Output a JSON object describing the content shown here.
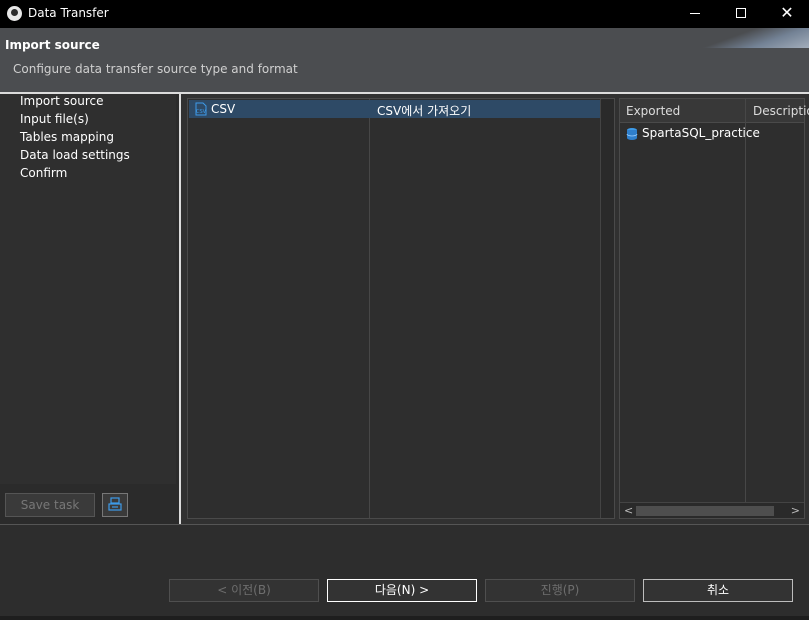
{
  "window": {
    "title": "Data Transfer",
    "controls": {
      "minimize": "minimize",
      "maximize": "maximize",
      "close": "✕"
    }
  },
  "header": {
    "title": "Import source",
    "description": "Configure data transfer source type and format"
  },
  "nav": {
    "items": [
      {
        "label": "Import source"
      },
      {
        "label": "Input file(s)"
      },
      {
        "label": "Tables mapping"
      },
      {
        "label": "Data load settings"
      },
      {
        "label": "Confirm"
      }
    ],
    "save_task_label": "Save task"
  },
  "source_table": {
    "rows": [
      {
        "icon": "csv-file-icon",
        "name": "CSV",
        "description": "CSV에서 가져오기"
      }
    ]
  },
  "export_table": {
    "columns": [
      "Exported",
      "Descriptio"
    ],
    "rows": [
      {
        "icon": "database-icon",
        "name": "SpartaSQL_practice",
        "description": ""
      }
    ],
    "scroll_left": "<",
    "scroll_right": ">"
  },
  "footer": {
    "back_label": "< 이전(B)",
    "next_label": "다음(N) >",
    "proceed_label": "진행(P)",
    "cancel_label": "취소"
  },
  "colors": {
    "selected_row": "#2e4a66",
    "header_bg": "#4b4d50",
    "accent_icon": "#3d9be9"
  }
}
